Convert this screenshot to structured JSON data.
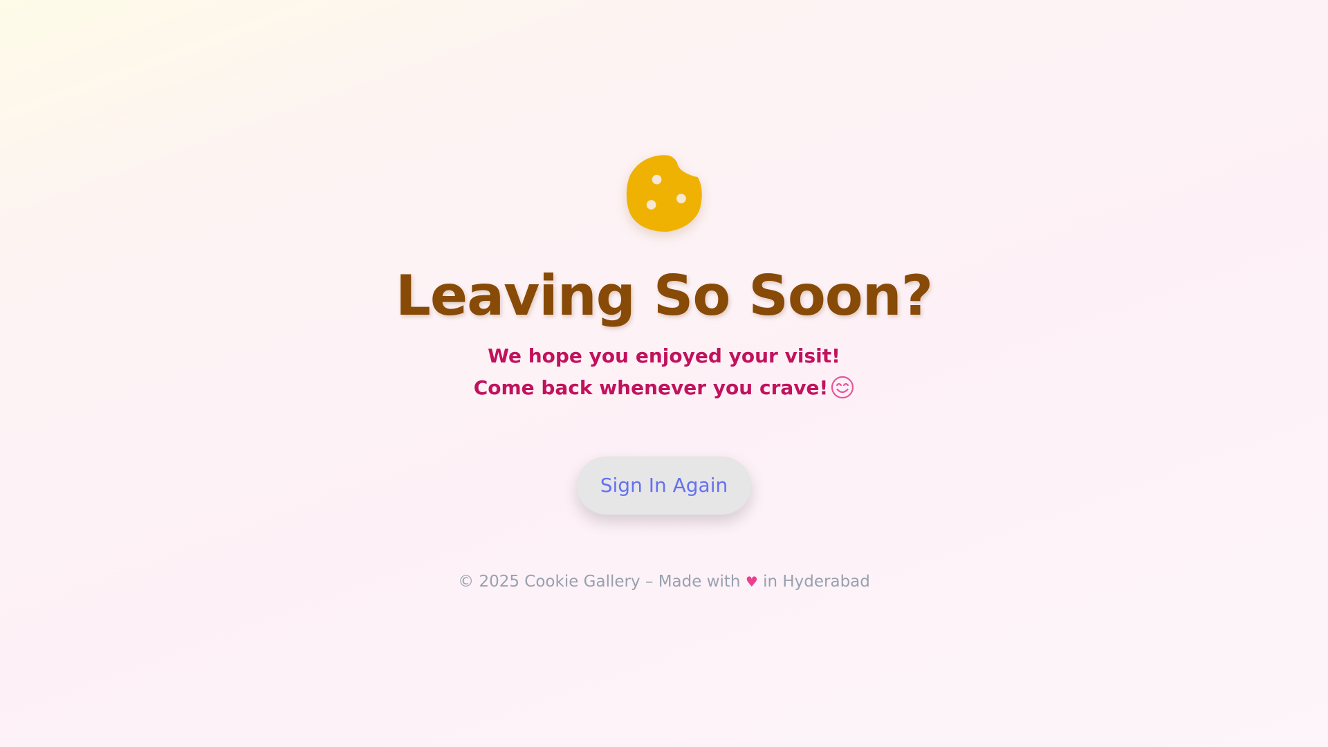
{
  "page": {
    "title": "Leaving So Soon?",
    "subtitle_line1": "We hope you enjoyed your visit!",
    "subtitle_line2": "Come back whenever you crave!",
    "subtitle_icon": "smiling-face-icon",
    "logo_icon": "cookie-icon"
  },
  "actions": {
    "sign_in_label": "Sign In Again"
  },
  "footer": {
    "prefix": "© 2025 Cookie Gallery – Made with",
    "heart": "♥",
    "suffix": "in Hyderabad"
  },
  "colors": {
    "title": "#874a07",
    "subtitle": "#c1125d",
    "cookie": "#f0b202",
    "button_text": "#6470f2",
    "button_bg": "#e6e6e6",
    "heart": "#ec3f92",
    "footer_text": "#98a0ae"
  }
}
